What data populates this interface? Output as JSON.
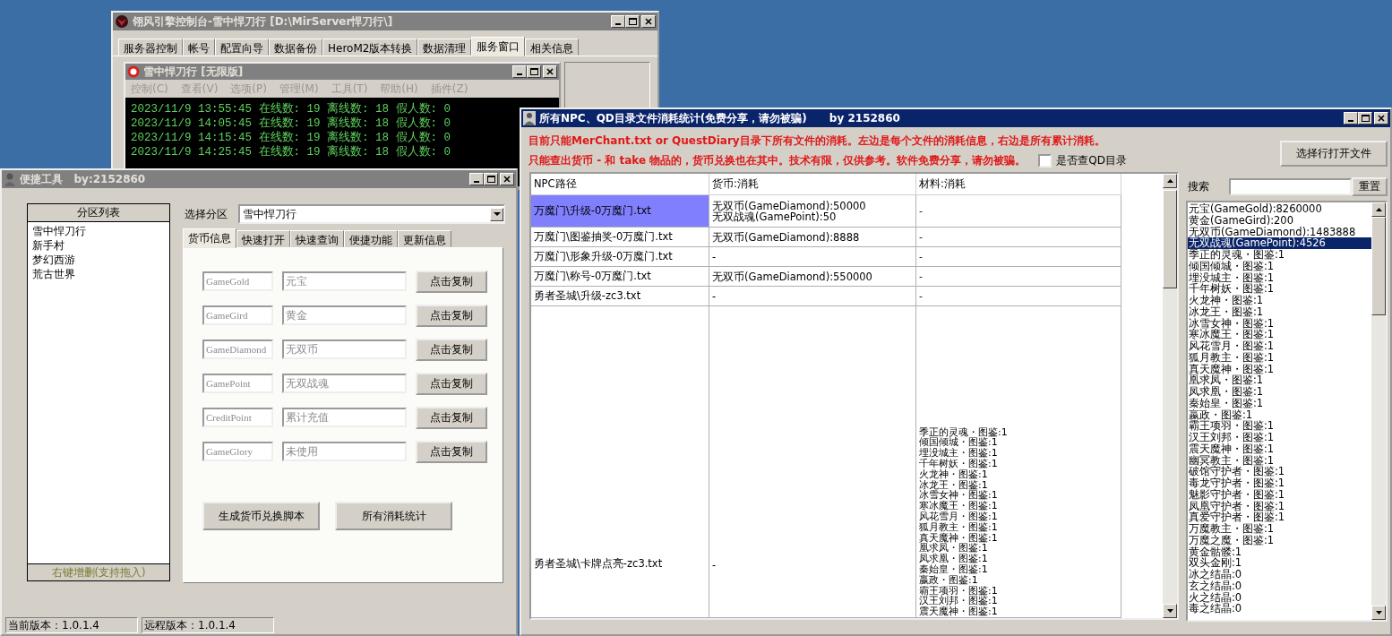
{
  "console_window": {
    "title": "翎风引擎控制台-雪中悍刀行 [D:\\MirServer悍刀行\\]",
    "tabs": [
      {
        "label": "服务器控制",
        "selected": false
      },
      {
        "label": "帐号",
        "selected": false
      },
      {
        "label": "配置向导",
        "selected": false
      },
      {
        "label": "数据备份",
        "selected": false
      },
      {
        "label": "HeroM2版本转换",
        "selected": false
      },
      {
        "label": "数据清理",
        "selected": false
      },
      {
        "label": "服务窗口",
        "selected": true
      },
      {
        "label": "相关信息",
        "selected": false
      }
    ],
    "child_window": {
      "title": "雪中悍刀行 [无限版]",
      "menu": [
        {
          "label": "控制(C)",
          "disabled": true
        },
        {
          "label": "查看(V)",
          "disabled": true
        },
        {
          "label": "选项(P)",
          "disabled": true
        },
        {
          "label": "管理(M)",
          "disabled": true
        },
        {
          "label": "工具(T)",
          "disabled": true
        },
        {
          "label": "帮助(H)",
          "disabled": true
        },
        {
          "label": "插件(Z)",
          "disabled": true
        }
      ],
      "log": [
        "2023/11/9 13:55:45 在线数: 19 离线数: 18 假人数: 0",
        "2023/11/9 14:05:45 在线数: 19 离线数: 18 假人数: 0",
        "2023/11/9 14:15:45 在线数: 19 离线数: 18 假人数: 0",
        "2023/11/9 14:25:45 在线数: 19 离线数: 18 假人数: 0"
      ]
    }
  },
  "tool_window": {
    "title": "便捷工具   by:2152860",
    "partition_list": {
      "header": "分区列表",
      "items": [
        "雪中悍刀行",
        "新手村",
        "梦幻西游",
        "荒古世界"
      ],
      "footer": "右键增删(支持拖入)"
    },
    "select_label": "选择分区",
    "select_value": "雪中悍刀行",
    "tabs": [
      {
        "label": "货币信息",
        "selected": true
      },
      {
        "label": "快速打开",
        "selected": false
      },
      {
        "label": "快速查询",
        "selected": false
      },
      {
        "label": "便捷功能",
        "selected": false
      },
      {
        "label": "更新信息",
        "selected": false
      }
    ],
    "currency_rows": [
      {
        "code": {
          "placeholder": "GameGold"
        },
        "name": {
          "placeholder": "元宝"
        },
        "button": "点击复制"
      },
      {
        "code": {
          "placeholder": "GameGird"
        },
        "name": {
          "placeholder": "黄金"
        },
        "button": "点击复制"
      },
      {
        "code": {
          "placeholder": "GameDiamond"
        },
        "name": {
          "placeholder": "无双币"
        },
        "button": "点击复制"
      },
      {
        "code": {
          "placeholder": "GamePoint"
        },
        "name": {
          "placeholder": "无双战魂"
        },
        "button": "点击复制"
      },
      {
        "code": {
          "placeholder": "CreditPoint"
        },
        "name": {
          "placeholder": "累计充值"
        },
        "button": "点击复制"
      },
      {
        "code": {
          "placeholder": "GameGlory"
        },
        "name": {
          "placeholder": "未使用"
        },
        "button": "点击复制"
      }
    ],
    "buttons": [
      "生成货币兑换脚本",
      "所有消耗统计"
    ],
    "status_bar": [
      "当前版本：1.0.1.4",
      "远程版本：1.0.1.4"
    ]
  },
  "stats_window": {
    "title": "所有NPC、QD目录文件消耗统计(免费分享，请勿被骗)      by 2152860",
    "notes": [
      "目前只能MerChant.txt or QuestDiary目录下所有文件的消耗。左边是每个文件的消耗信息，右边是所有累计消耗。",
      "只能查出货币 - 和 take 物品的，货币兑换也在其中。技术有限，仅供参考。软件免费分享，请勿被骗。"
    ],
    "qd_checkbox": {
      "label": "是否查QD目录",
      "checked": false
    },
    "open_button": "选择行打开文件",
    "search": {
      "label": "搜索",
      "button": "重置"
    },
    "table": {
      "columns": [
        "NPC路径",
        "货币:消耗",
        "材料:消耗"
      ],
      "rows": [
        {
          "path": "万魔门\\升级-0万魔门.txt",
          "currency": [
            "无双币(GameDiamond):50000",
            "无双战魂(GamePoint):50"
          ],
          "materials": [
            "-"
          ],
          "selected": true
        },
        {
          "path": "万魔门\\图鉴抽奖-0万魔门.txt",
          "currency": [
            "无双币(GameDiamond):8888"
          ],
          "materials": [
            "-"
          ],
          "selected": false
        },
        {
          "path": "万魔门\\形象升级-0万魔门.txt",
          "currency": [
            "-"
          ],
          "materials": [
            "-"
          ],
          "selected": false
        },
        {
          "path": "万魔门\\称号-0万魔门.txt",
          "currency": [
            "无双币(GameDiamond):550000"
          ],
          "materials": [
            "-"
          ],
          "selected": false
        },
        {
          "path": "勇者圣城\\升级-zc3.txt",
          "currency": [
            "-"
          ],
          "materials": [
            "-"
          ],
          "selected": false
        },
        {
          "path": "勇者圣城\\卡牌点亮-zc3.txt",
          "currency": [
            "-"
          ],
          "materials": [
            "季正的灵魂・图鉴:1",
            "倾国倾城・图鉴:1",
            "埋没城主・图鉴:1",
            "千年树妖・图鉴:1",
            "火龙神・图鉴:1",
            "冰龙王・图鉴:1",
            "冰雪女神・图鉴:1",
            "寒冰魔王・图鉴:1",
            "风花雪月・图鉴:1",
            "狐月教主・图鉴:1",
            "真天魔神・图鉴:1",
            "凰求凤・图鉴:1",
            "凤求凰・图鉴:1",
            "秦始皇・图鉴:1",
            "嬴政・图鉴:1",
            "霸王项羽・图鉴:1",
            "汉王刘邦・图鉴:1",
            "震天魔神・图鉴:1"
          ],
          "selected": false
        }
      ]
    },
    "totals": [
      {
        "label": "元宝(GameGold):8260000",
        "selected": false
      },
      {
        "label": "黄金(GameGird):200",
        "selected": false
      },
      {
        "label": "无双币(GameDiamond):1483888",
        "selected": false
      },
      {
        "label": "无双战魂(GamePoint):4526",
        "selected": true
      },
      {
        "label": "季正的灵魂・图鉴:1",
        "selected": false
      },
      {
        "label": "倾国倾城・图鉴:1",
        "selected": false
      },
      {
        "label": "埋没城主・图鉴:1",
        "selected": false
      },
      {
        "label": "千年树妖・图鉴:1",
        "selected": false
      },
      {
        "label": "火龙神・图鉴:1",
        "selected": false
      },
      {
        "label": "冰龙王・图鉴:1",
        "selected": false
      },
      {
        "label": "冰雪女神・图鉴:1",
        "selected": false
      },
      {
        "label": "寒冰魔王・图鉴:1",
        "selected": false
      },
      {
        "label": "风花雪月・图鉴:1",
        "selected": false
      },
      {
        "label": "狐月教主・图鉴:1",
        "selected": false
      },
      {
        "label": "真天魔神・图鉴:1",
        "selected": false
      },
      {
        "label": "凰求凤・图鉴:1",
        "selected": false
      },
      {
        "label": "凤求凰・图鉴:1",
        "selected": false
      },
      {
        "label": "秦始皇・图鉴:1",
        "selected": false
      },
      {
        "label": "嬴政・图鉴:1",
        "selected": false
      },
      {
        "label": "霸王项羽・图鉴:1",
        "selected": false
      },
      {
        "label": "汉王刘邦・图鉴:1",
        "selected": false
      },
      {
        "label": "震天魔神・图鉴:1",
        "selected": false
      },
      {
        "label": "幽冥教主・图鉴:1",
        "selected": false
      },
      {
        "label": "破馆守护者・图鉴:1",
        "selected": false
      },
      {
        "label": "毒龙守护者・图鉴:1",
        "selected": false
      },
      {
        "label": "魅影守护者・图鉴:1",
        "selected": false
      },
      {
        "label": "凤凰守护者・图鉴:1",
        "selected": false
      },
      {
        "label": "真爱守护者・图鉴:1",
        "selected": false
      },
      {
        "label": "万魔教主・图鉴:1",
        "selected": false
      },
      {
        "label": "万魔之魔・图鉴:1",
        "selected": false
      },
      {
        "label": "黄金骷髅:1",
        "selected": false
      },
      {
        "label": "双头金刚:1",
        "selected": false
      },
      {
        "label": "冰之结晶:0",
        "selected": false
      },
      {
        "label": "玄之结晶:0",
        "selected": false
      },
      {
        "label": "火之结晶:0",
        "selected": false
      },
      {
        "label": "毒之结晶:0",
        "selected": false
      }
    ]
  }
}
